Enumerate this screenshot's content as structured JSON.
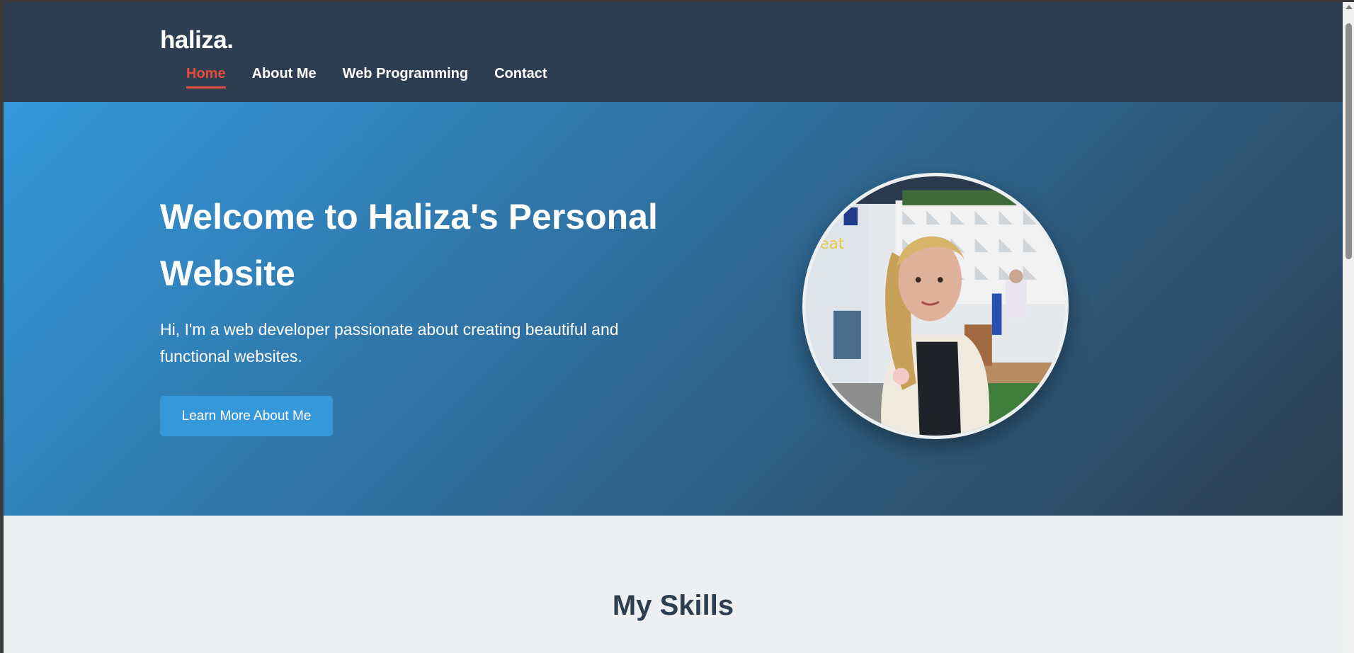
{
  "header": {
    "logo": "haliza.",
    "nav": [
      {
        "label": "Home",
        "active": true
      },
      {
        "label": "About Me",
        "active": false
      },
      {
        "label": "Web Programming",
        "active": false
      },
      {
        "label": "Contact",
        "active": false
      }
    ]
  },
  "hero": {
    "title": "Welcome to Haliza's Personal Website",
    "subtitle": "Hi, I'm a web developer passionate about creating beautiful and functional websites.",
    "cta_label": "Learn More About Me"
  },
  "skills": {
    "title": "My Skills"
  },
  "colors": {
    "header_bg": "#2c3e50",
    "accent": "#e74c3c",
    "primary": "#3498db",
    "page_bg": "#ecf0f1"
  }
}
